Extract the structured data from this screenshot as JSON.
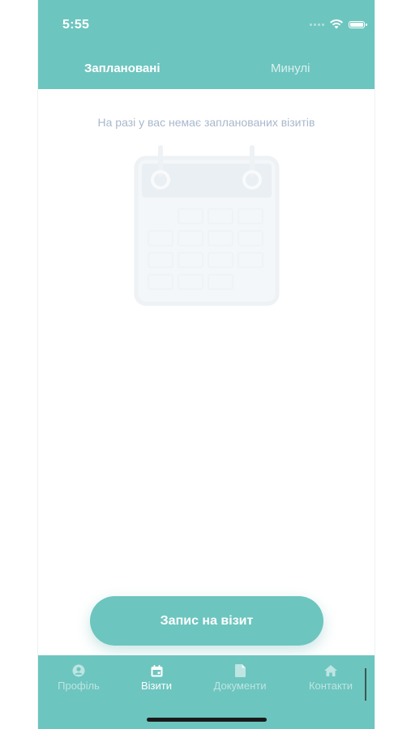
{
  "status_bar": {
    "time": "5:55",
    "icons": [
      "signal-icon",
      "wifi-icon",
      "battery-icon"
    ]
  },
  "tabs": [
    {
      "label": "Заплановані",
      "active": true
    },
    {
      "label": "Минулі",
      "active": false
    }
  ],
  "empty_state": {
    "message": "На разі у вас немає запланованих візитів",
    "illustration": "calendar-icon"
  },
  "cta_button": {
    "label": "Запис на візит"
  },
  "bottom_nav": [
    {
      "label": "Профіль",
      "icon": "profile-icon",
      "active": false
    },
    {
      "label": "Візити",
      "icon": "calendar-icon",
      "active": true
    },
    {
      "label": "Документи",
      "icon": "document-icon",
      "active": false
    },
    {
      "label": "Контакти",
      "icon": "home-icon",
      "active": false
    }
  ],
  "colors": {
    "primary": "#6dc5bf",
    "empty_text": "#a8b8cc",
    "illustration": "#eef3f6"
  }
}
